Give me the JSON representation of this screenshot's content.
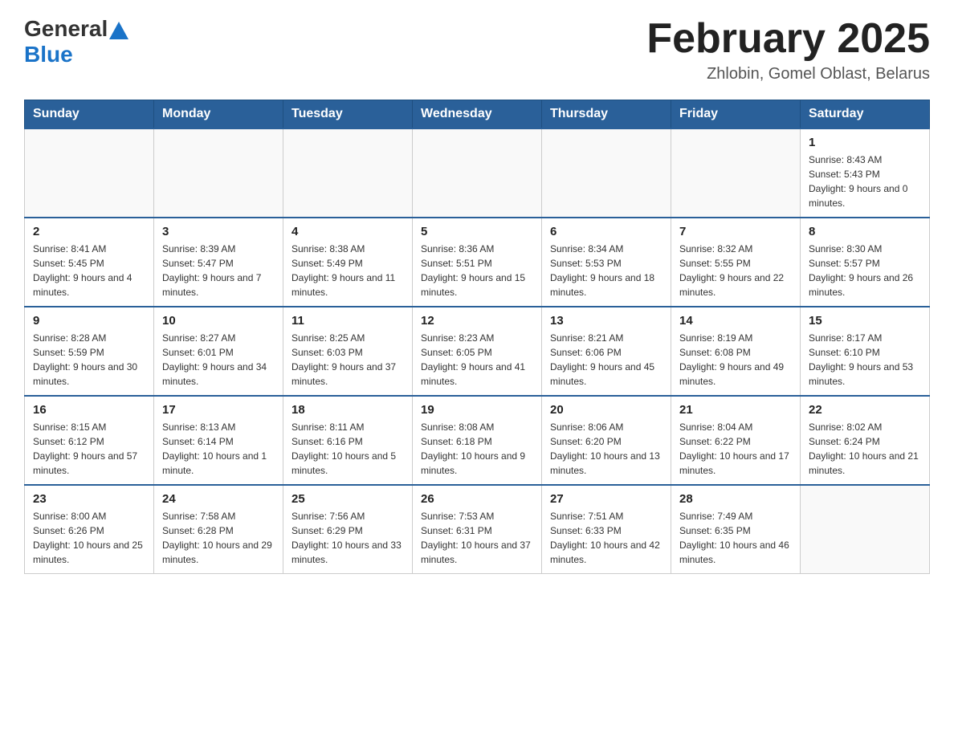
{
  "header": {
    "logo_general": "General",
    "logo_blue": "Blue",
    "month_title": "February 2025",
    "location": "Zhlobin, Gomel Oblast, Belarus"
  },
  "calendar": {
    "days_of_week": [
      "Sunday",
      "Monday",
      "Tuesday",
      "Wednesday",
      "Thursday",
      "Friday",
      "Saturday"
    ],
    "weeks": [
      {
        "days": [
          {
            "num": "",
            "info": ""
          },
          {
            "num": "",
            "info": ""
          },
          {
            "num": "",
            "info": ""
          },
          {
            "num": "",
            "info": ""
          },
          {
            "num": "",
            "info": ""
          },
          {
            "num": "",
            "info": ""
          },
          {
            "num": "1",
            "info": "Sunrise: 8:43 AM\nSunset: 5:43 PM\nDaylight: 9 hours and 0 minutes."
          }
        ]
      },
      {
        "days": [
          {
            "num": "2",
            "info": "Sunrise: 8:41 AM\nSunset: 5:45 PM\nDaylight: 9 hours and 4 minutes."
          },
          {
            "num": "3",
            "info": "Sunrise: 8:39 AM\nSunset: 5:47 PM\nDaylight: 9 hours and 7 minutes."
          },
          {
            "num": "4",
            "info": "Sunrise: 8:38 AM\nSunset: 5:49 PM\nDaylight: 9 hours and 11 minutes."
          },
          {
            "num": "5",
            "info": "Sunrise: 8:36 AM\nSunset: 5:51 PM\nDaylight: 9 hours and 15 minutes."
          },
          {
            "num": "6",
            "info": "Sunrise: 8:34 AM\nSunset: 5:53 PM\nDaylight: 9 hours and 18 minutes."
          },
          {
            "num": "7",
            "info": "Sunrise: 8:32 AM\nSunset: 5:55 PM\nDaylight: 9 hours and 22 minutes."
          },
          {
            "num": "8",
            "info": "Sunrise: 8:30 AM\nSunset: 5:57 PM\nDaylight: 9 hours and 26 minutes."
          }
        ]
      },
      {
        "days": [
          {
            "num": "9",
            "info": "Sunrise: 8:28 AM\nSunset: 5:59 PM\nDaylight: 9 hours and 30 minutes."
          },
          {
            "num": "10",
            "info": "Sunrise: 8:27 AM\nSunset: 6:01 PM\nDaylight: 9 hours and 34 minutes."
          },
          {
            "num": "11",
            "info": "Sunrise: 8:25 AM\nSunset: 6:03 PM\nDaylight: 9 hours and 37 minutes."
          },
          {
            "num": "12",
            "info": "Sunrise: 8:23 AM\nSunset: 6:05 PM\nDaylight: 9 hours and 41 minutes."
          },
          {
            "num": "13",
            "info": "Sunrise: 8:21 AM\nSunset: 6:06 PM\nDaylight: 9 hours and 45 minutes."
          },
          {
            "num": "14",
            "info": "Sunrise: 8:19 AM\nSunset: 6:08 PM\nDaylight: 9 hours and 49 minutes."
          },
          {
            "num": "15",
            "info": "Sunrise: 8:17 AM\nSunset: 6:10 PM\nDaylight: 9 hours and 53 minutes."
          }
        ]
      },
      {
        "days": [
          {
            "num": "16",
            "info": "Sunrise: 8:15 AM\nSunset: 6:12 PM\nDaylight: 9 hours and 57 minutes."
          },
          {
            "num": "17",
            "info": "Sunrise: 8:13 AM\nSunset: 6:14 PM\nDaylight: 10 hours and 1 minute."
          },
          {
            "num": "18",
            "info": "Sunrise: 8:11 AM\nSunset: 6:16 PM\nDaylight: 10 hours and 5 minutes."
          },
          {
            "num": "19",
            "info": "Sunrise: 8:08 AM\nSunset: 6:18 PM\nDaylight: 10 hours and 9 minutes."
          },
          {
            "num": "20",
            "info": "Sunrise: 8:06 AM\nSunset: 6:20 PM\nDaylight: 10 hours and 13 minutes."
          },
          {
            "num": "21",
            "info": "Sunrise: 8:04 AM\nSunset: 6:22 PM\nDaylight: 10 hours and 17 minutes."
          },
          {
            "num": "22",
            "info": "Sunrise: 8:02 AM\nSunset: 6:24 PM\nDaylight: 10 hours and 21 minutes."
          }
        ]
      },
      {
        "days": [
          {
            "num": "23",
            "info": "Sunrise: 8:00 AM\nSunset: 6:26 PM\nDaylight: 10 hours and 25 minutes."
          },
          {
            "num": "24",
            "info": "Sunrise: 7:58 AM\nSunset: 6:28 PM\nDaylight: 10 hours and 29 minutes."
          },
          {
            "num": "25",
            "info": "Sunrise: 7:56 AM\nSunset: 6:29 PM\nDaylight: 10 hours and 33 minutes."
          },
          {
            "num": "26",
            "info": "Sunrise: 7:53 AM\nSunset: 6:31 PM\nDaylight: 10 hours and 37 minutes."
          },
          {
            "num": "27",
            "info": "Sunrise: 7:51 AM\nSunset: 6:33 PM\nDaylight: 10 hours and 42 minutes."
          },
          {
            "num": "28",
            "info": "Sunrise: 7:49 AM\nSunset: 6:35 PM\nDaylight: 10 hours and 46 minutes."
          },
          {
            "num": "",
            "info": ""
          }
        ]
      }
    ]
  }
}
